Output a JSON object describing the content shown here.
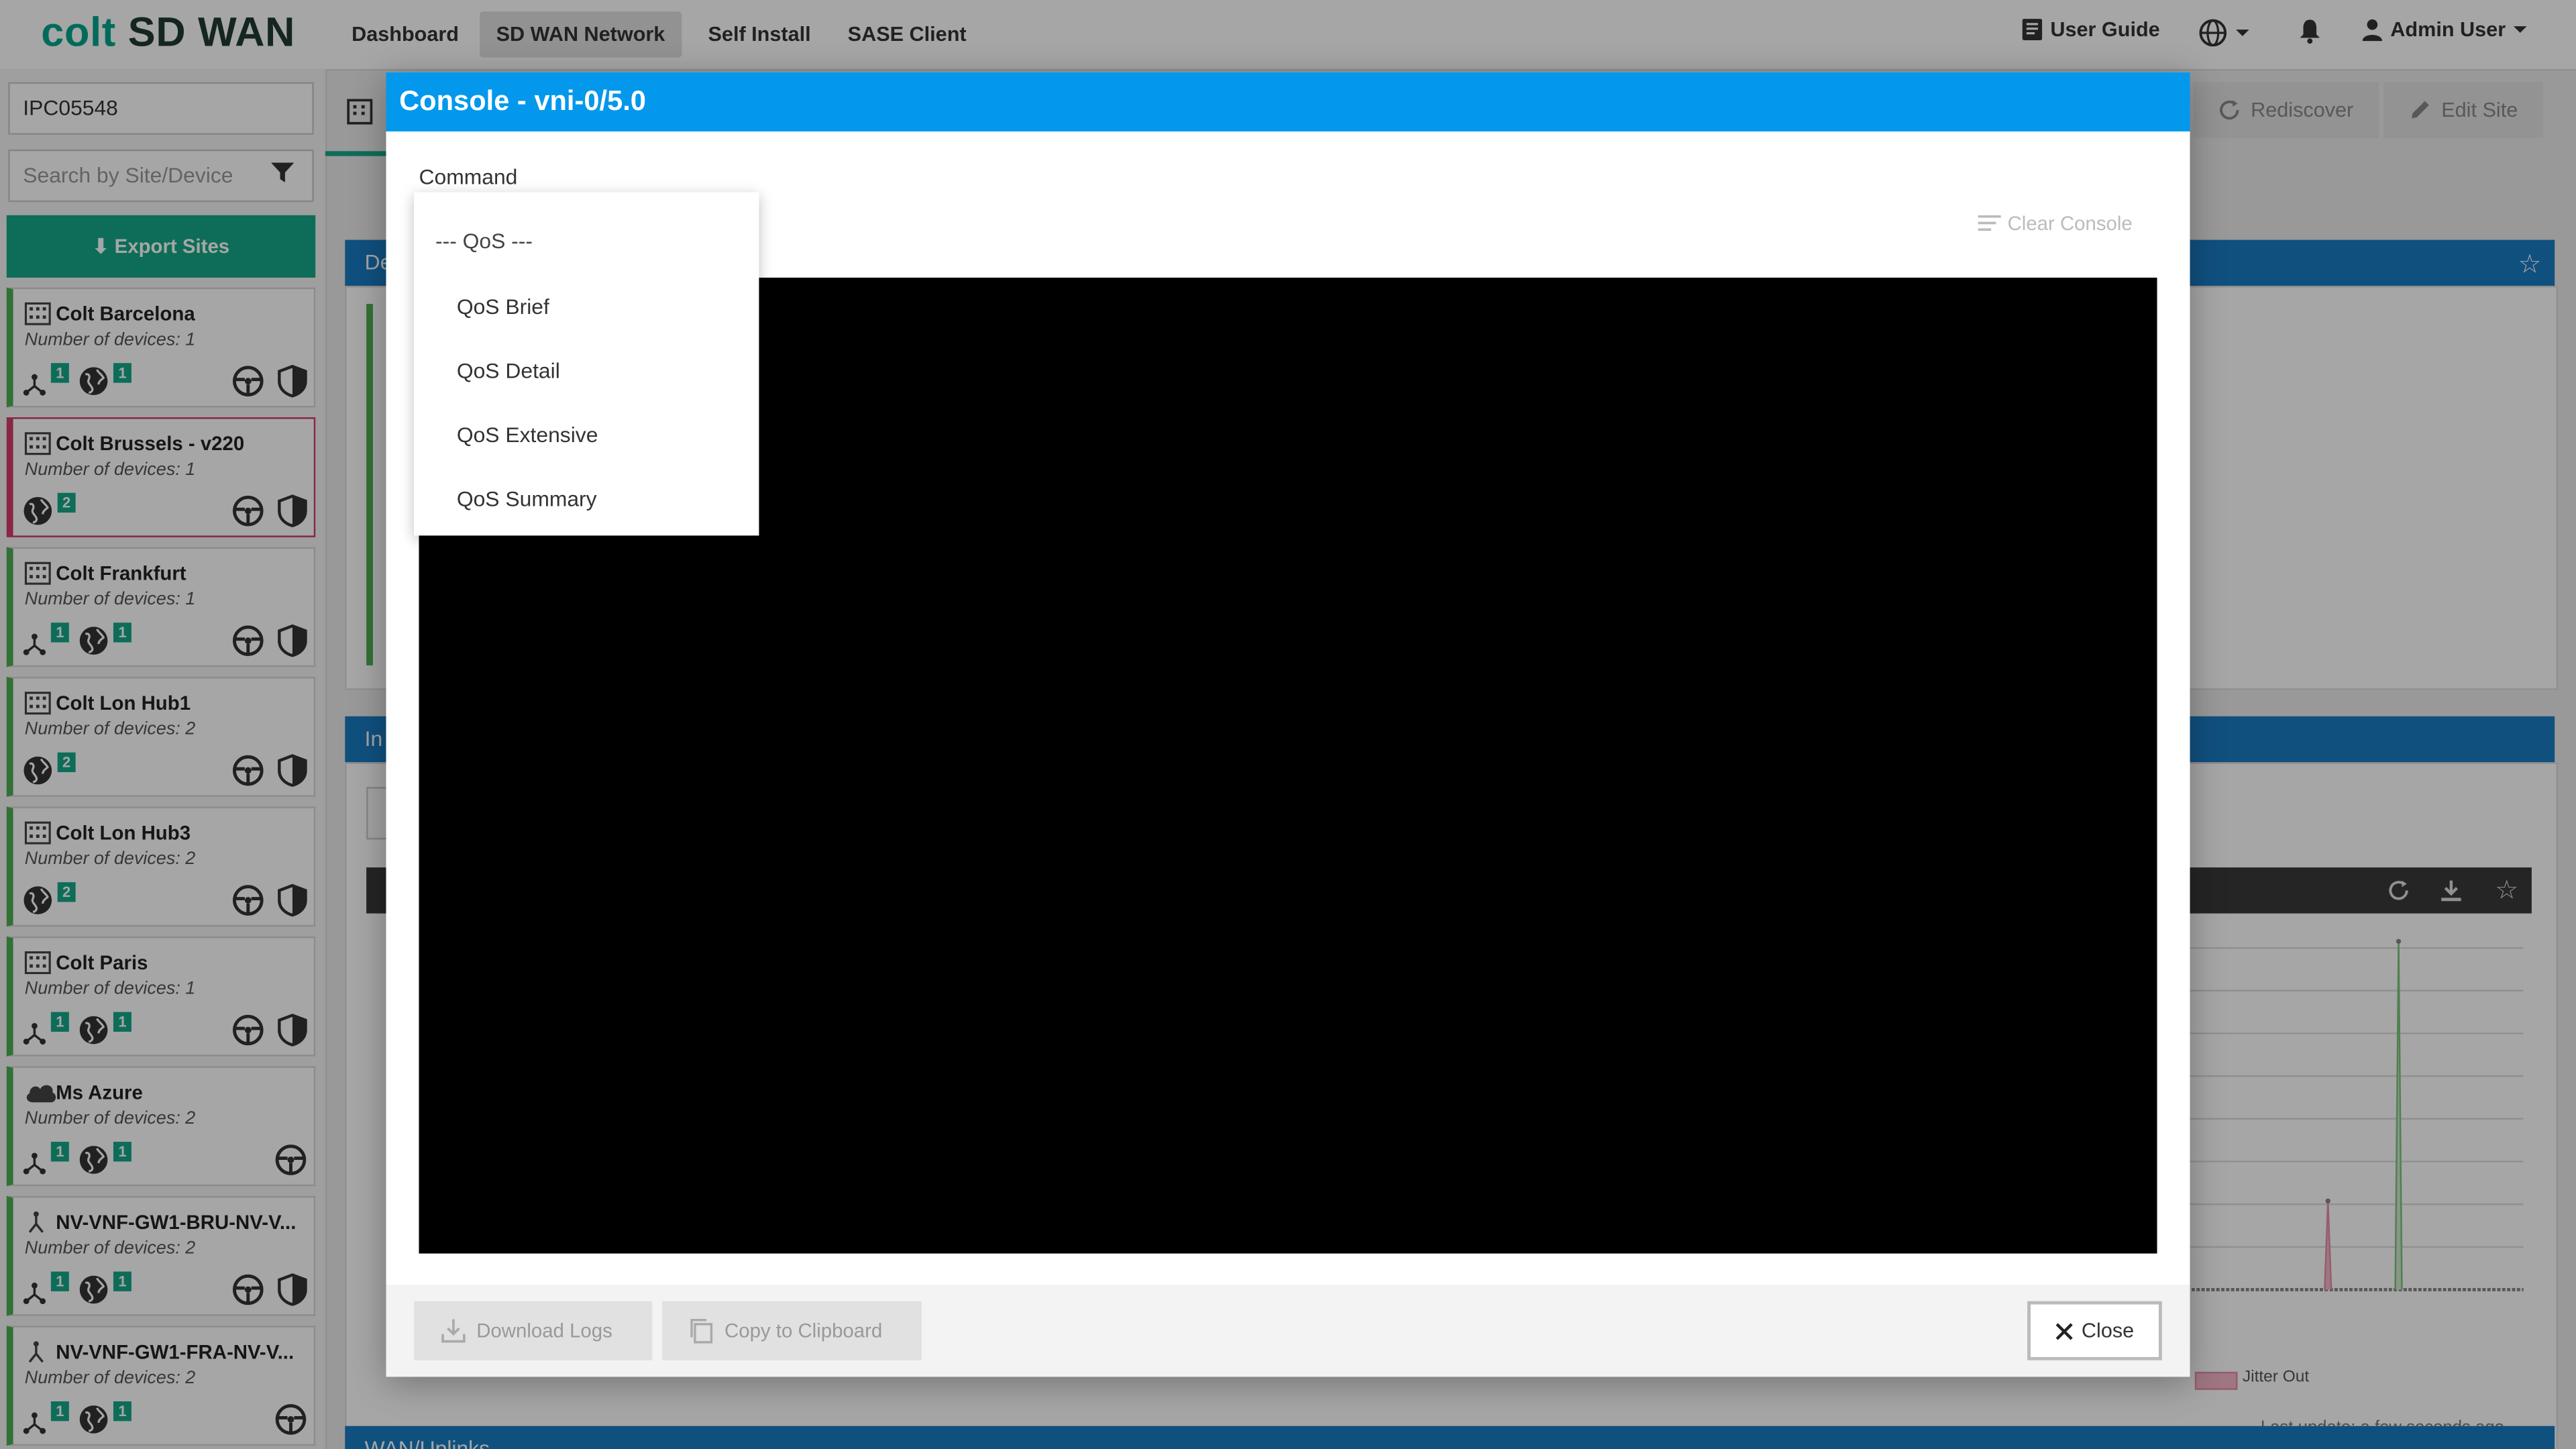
{
  "topbar": {
    "logo_brand": "colt",
    "logo_product": "SD WAN",
    "nav": [
      "Dashboard",
      "SD WAN Network",
      "Self Install",
      "SASE Client"
    ],
    "active_nav": "SD WAN Network",
    "user_guide": "User Guide",
    "user": "Admin User"
  },
  "sidebar": {
    "search_value": "IPC05548",
    "search_placeholder": "Search by Site/Device",
    "export_label": "Export Sites",
    "sites": [
      {
        "name": "Colt Barcelona",
        "devices": "Number of devices: 1",
        "net": "1",
        "globe": "1"
      },
      {
        "name": "Colt Brussels - v220",
        "devices": "Number of devices: 1",
        "globe": "2"
      },
      {
        "name": "Colt Frankfurt",
        "devices": "Number of devices: 1",
        "net": "1",
        "globe": "1"
      },
      {
        "name": "Colt Lon Hub1",
        "devices": "Number of devices: 2",
        "globe": "2"
      },
      {
        "name": "Colt Lon Hub3",
        "devices": "Number of devices: 2",
        "globe": "2"
      },
      {
        "name": "Colt Paris",
        "devices": "Number of devices: 1",
        "net": "1",
        "globe": "1"
      },
      {
        "name": "Ms Azure",
        "devices": "Number of devices: 2",
        "net": "1",
        "globe": "1"
      },
      {
        "name": "NV-VNF-GW1-BRU-NV-V...",
        "devices": "Number of devices: 2",
        "net": "1",
        "globe": "1"
      },
      {
        "name": "NV-VNF-GW1-FRA-NV-V...",
        "devices": "Number of devices: 2",
        "net": "1",
        "globe": "1"
      }
    ]
  },
  "background": {
    "rediscover": "Rediscover",
    "edit_site": "Edit Site",
    "legend_jitter_out": "Jitter Out",
    "last_update": "Last update: a few seconds ago",
    "wan_uplinks": "WAN/Uplinks",
    "strip_left_1": "De",
    "strip_left_2": "In"
  },
  "modal": {
    "title": "Console - vni-0/5.0",
    "command_label": "Command",
    "clear_console": "Clear Console",
    "download_logs": "Download Logs",
    "copy_clipboard": "Copy to Clipboard",
    "close": "Close"
  },
  "dropdown": {
    "group": "--- QoS ---",
    "options": [
      "QoS Brief",
      "QoS Detail",
      "QoS Extensive",
      "QoS Summary"
    ]
  },
  "colors": {
    "accent": "#14a887",
    "header_blue": "#0398ec",
    "site_green": "#4caf50",
    "site_red": "#d33c6b"
  }
}
